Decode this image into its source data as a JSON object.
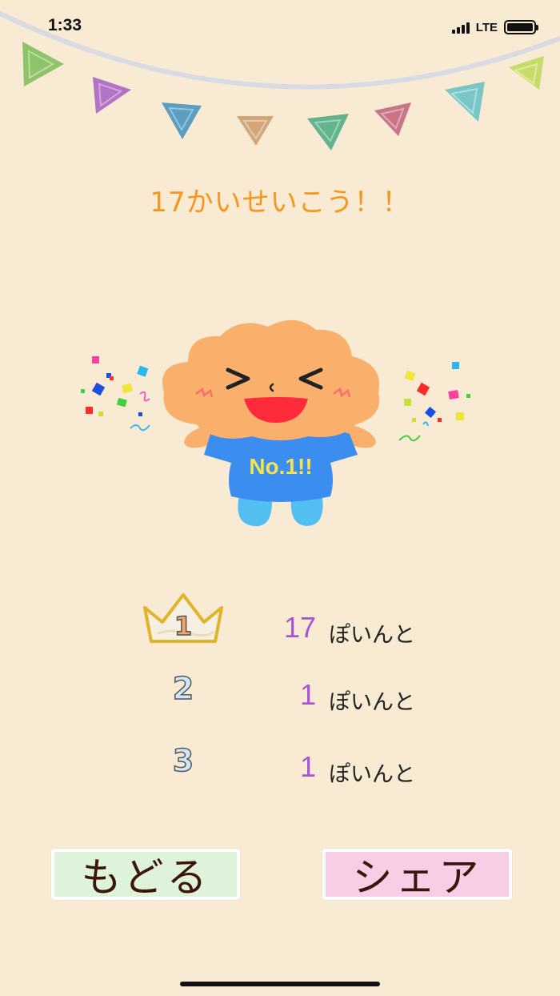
{
  "status": {
    "time": "1:33",
    "network": "LTE"
  },
  "title": "17かいせいこう！！",
  "mascot": {
    "shirt_text": "No.1!!"
  },
  "ranking": [
    {
      "rank": "1",
      "score": "17",
      "unit": "ぽいんと"
    },
    {
      "rank": "2",
      "score": "1",
      "unit": "ぽいんと"
    },
    {
      "rank": "3",
      "score": "1",
      "unit": "ぽいんと"
    }
  ],
  "buttons": {
    "back": "もどる",
    "share": "シェア"
  },
  "colors": {
    "background": "#f8ead3",
    "title": "#f3971e",
    "score": "#a855d4",
    "back_button": "#dff3da",
    "share_button": "#f8cde6"
  }
}
